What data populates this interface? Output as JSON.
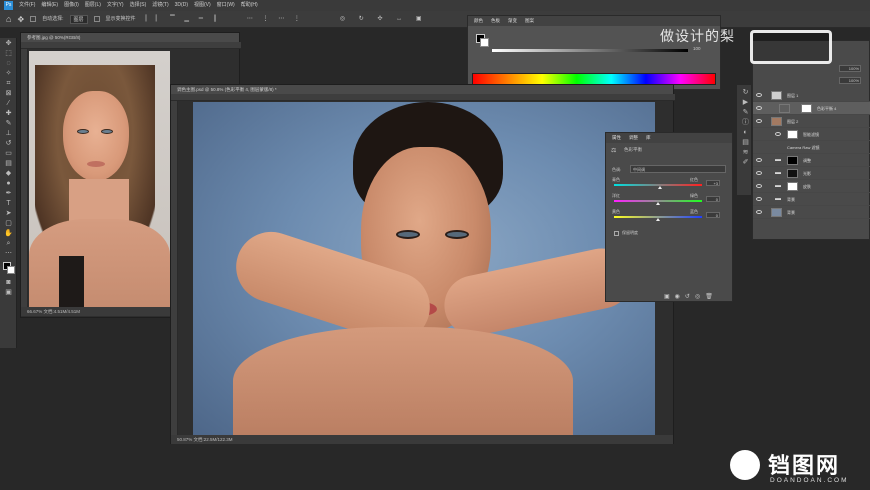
{
  "menubar": {
    "logo": "Ps",
    "items": [
      "文件(F)",
      "编辑(E)",
      "图像(I)",
      "图层(L)",
      "文字(Y)",
      "选择(S)",
      "滤镜(T)",
      "3D(D)",
      "视图(V)",
      "窗口(W)",
      "帮助(H)"
    ]
  },
  "options": {
    "auto_select_label": "自动选择:",
    "auto_select_value": "图层",
    "transform_label": "显示变换控件"
  },
  "doc1": {
    "tab": "参考图.jpg @ 50%(RGB/8)",
    "status": "66.67%   文档:4.51M/4.51M"
  },
  "doc2": {
    "tab": "调色主图.psd @ 50.8% (色彩平衡 4, 图层蒙版/8) *",
    "status": "50.87%   文档:22.5M/122.3M"
  },
  "color_panel": {
    "tabs": [
      "颜色",
      "色板",
      "渐变",
      "图案"
    ],
    "k_value": "100"
  },
  "properties": {
    "tabs": [
      "属性",
      "调整",
      "库"
    ],
    "title": "色彩平衡",
    "tone_label": "色调:",
    "tone_value": "中间调",
    "sliders": [
      {
        "left": "青色",
        "right": "红色",
        "value": "+3"
      },
      {
        "left": "洋红",
        "right": "绿色",
        "value": "0"
      },
      {
        "left": "黄色",
        "right": "蓝色",
        "value": "0"
      }
    ],
    "preserve_label": "保留明度"
  },
  "layers": {
    "rows": [
      {
        "name": "图层 1"
      },
      {
        "name": "色彩平衡 4"
      },
      {
        "name": "图层 2"
      },
      {
        "name": "智能滤镜"
      },
      {
        "name": "Camera Raw 滤镜"
      },
      {
        "name": "调整"
      },
      {
        "name": "光影"
      },
      {
        "name": "皮肤"
      },
      {
        "name": "背景"
      },
      {
        "name": "背景"
      }
    ],
    "opacity": "100%",
    "fill": "100%"
  },
  "watermarks": {
    "top_text": "做设计的梨",
    "bottom_logo_text": "铛图网",
    "bottom_url": "DOANDOAN.COM"
  },
  "colors": {
    "accent_blue": "#2b8ed7",
    "bg_canvas": "#6b8fb5"
  }
}
